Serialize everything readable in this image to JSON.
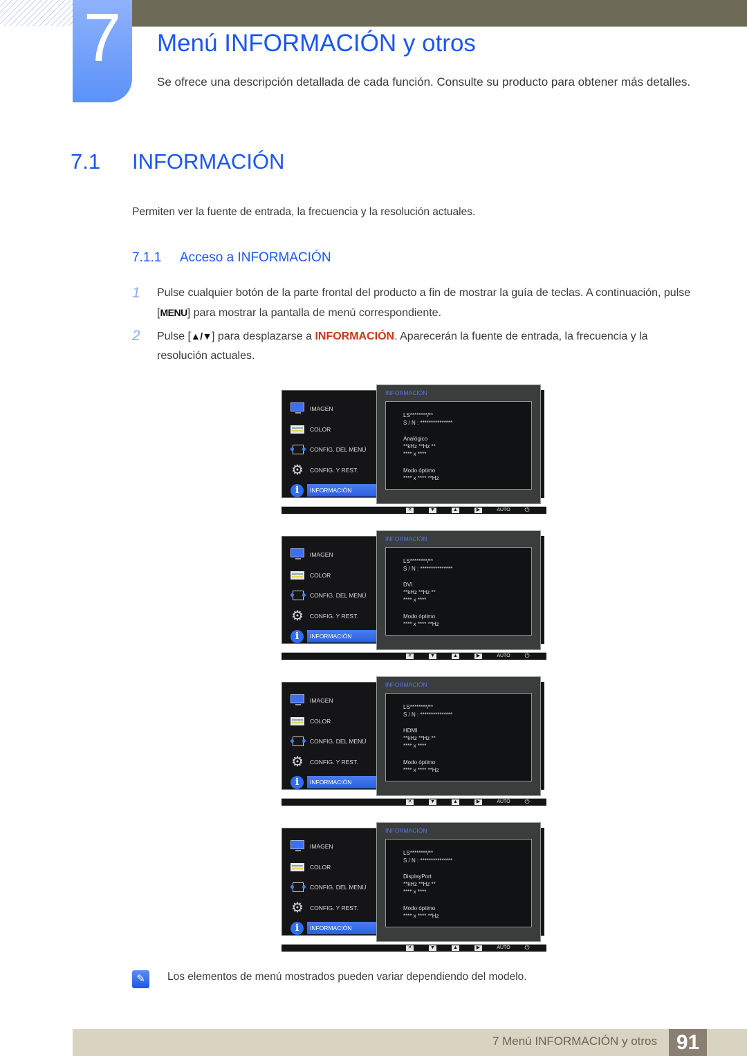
{
  "chapter": {
    "number": "7",
    "title": "Menú INFORMACIÓN y otros",
    "intro": "Se ofrece una descripción detallada de cada función. Consulte su producto para obtener más detalles."
  },
  "section": {
    "number": "7.1",
    "title": "INFORMACIÓN",
    "text": "Permiten ver la fuente de entrada, la frecuencia y la resolución actuales."
  },
  "subsection": {
    "number": "7.1.1",
    "title": "Acceso a INFORMACIÓN"
  },
  "steps": [
    {
      "num": "1",
      "pre": "Pulse cualquier botón de la parte frontal del producto a fin de mostrar la guía de teclas. A continuación, pulse [",
      "key": "MENU",
      "post": "] para mostrar la pantalla de menú correspondiente."
    },
    {
      "num": "2",
      "pre": "Pulse [",
      "key": "▲/▼",
      "mid": "] para desplazarse a ",
      "highlight": "INFORMACIÓN",
      "post": ". Aparecerán la fuente de entrada, la frecuencia y la resolución actuales."
    }
  ],
  "osd": {
    "menu": [
      {
        "label": "IMAGEN",
        "icon": "monitor-icon"
      },
      {
        "label": "COLOR",
        "icon": "color-icon"
      },
      {
        "label": "CONFIG. DEL MENÚ",
        "icon": "menu-config-icon"
      },
      {
        "label": "CONFIG. Y REST.",
        "icon": "gear-icon"
      },
      {
        "label": "INFORMACIÓN",
        "icon": "info-icon",
        "active": true
      }
    ],
    "panel_title": "INFORMACIÓN",
    "model": "LS********/**",
    "serial": "S / N : ***************",
    "frequency": "**kHz **Hz **",
    "resolution": "**** x ****",
    "optimal_label": "Modo óptimo",
    "optimal_value": "**** x **** **Hz",
    "buttons": {
      "close": "✕",
      "down": "▼",
      "up": "▲",
      "enter": "▶",
      "auto": "AUTO",
      "power": "⏻"
    },
    "screens": [
      {
        "source": "Analógico"
      },
      {
        "source": "DVI"
      },
      {
        "source": "HDMI"
      },
      {
        "source": "DisplayPort"
      }
    ]
  },
  "note": {
    "icon": "note-pencil-icon",
    "text": "Los elementos de menú mostrados pueden variar dependiendo del modelo."
  },
  "footer": {
    "label": "7 Menú INFORMACIÓN y otros",
    "page": "91"
  }
}
